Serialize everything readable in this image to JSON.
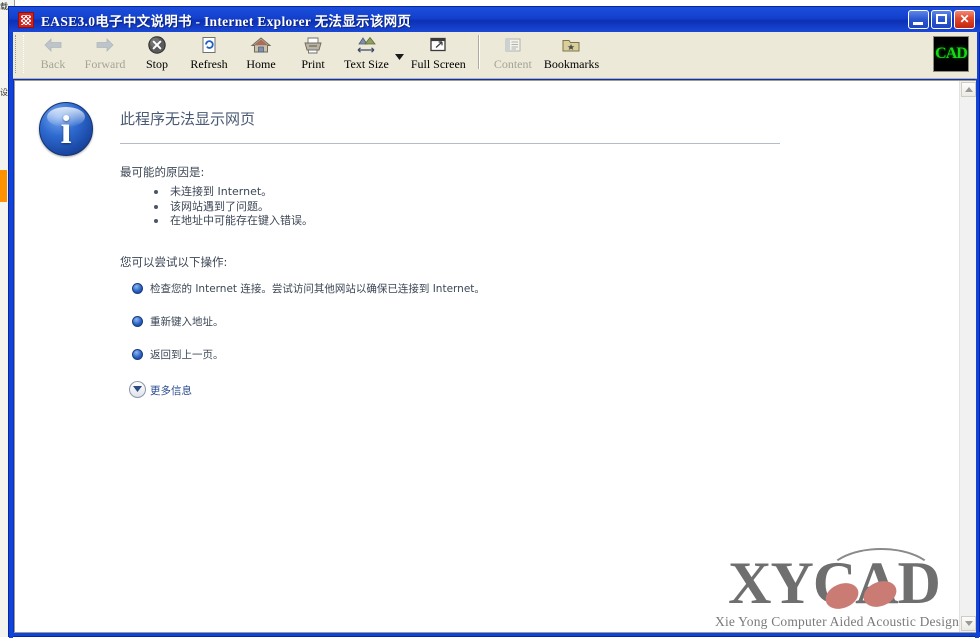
{
  "window": {
    "title": "EASE3.0电子中文说明书 - Internet Explorer 无法显示该网页",
    "app_icon": "app-icon",
    "controls": {
      "minimize": "Minimize",
      "maximize": "Maximize",
      "close": "Close"
    }
  },
  "background_window": {
    "edge_label_top": "载",
    "edge_label_mid": "设"
  },
  "toolbar": {
    "buttons": [
      {
        "label": "Back",
        "icon": "arrow-left-icon",
        "enabled": false
      },
      {
        "label": "Forward",
        "icon": "arrow-right-icon",
        "enabled": false
      },
      {
        "label": "Stop",
        "icon": "stop-icon",
        "enabled": true
      },
      {
        "label": "Refresh",
        "icon": "refresh-icon",
        "enabled": true
      },
      {
        "label": "Home",
        "icon": "home-icon",
        "enabled": true
      },
      {
        "label": "Print",
        "icon": "printer-icon",
        "enabled": true
      },
      {
        "label": "Text Size",
        "icon": "text-size-icon",
        "enabled": true
      },
      {
        "label": "Full Screen",
        "icon": "full-screen-icon",
        "enabled": true
      },
      {
        "label": "Content",
        "icon": "content-list-icon",
        "enabled": false
      },
      {
        "label": "Bookmarks",
        "icon": "bookmarks-icon",
        "enabled": true
      }
    ],
    "textsize_caret": "▾",
    "brand_logo_text": "CAD"
  },
  "page": {
    "heading": "此程序无法显示网页",
    "causes_heading": "最可能的原因是:",
    "causes": [
      "未连接到 Internet。",
      "该网站遇到了问题。",
      "在地址中可能存在键入错误。"
    ],
    "actions_heading": "您可以尝试以下操作:",
    "actions": [
      "检查您的 Internet 连接。尝试访问其他网站以确保已连接到 Internet。",
      "重新键入地址。",
      "返回到上一页。"
    ],
    "more_info_label": "更多信息",
    "more_info_chevron": "▼"
  },
  "watermark": {
    "main": "XYCAD",
    "subtitle": "Xie Yong Computer Aided Acoustic Design"
  },
  "scrollbar": {
    "up_arrow": "▲",
    "down_arrow": "▼"
  },
  "colors": {
    "titlebar_blue": "#1340cc",
    "toolbar_beige": "#ece9d8",
    "heading_slate": "#4a5a73",
    "link_blue": "#2a4c8f",
    "watermark_gray": "#6f6f6f",
    "accent_orange": "#ff9200",
    "close_red": "#e0472a"
  }
}
